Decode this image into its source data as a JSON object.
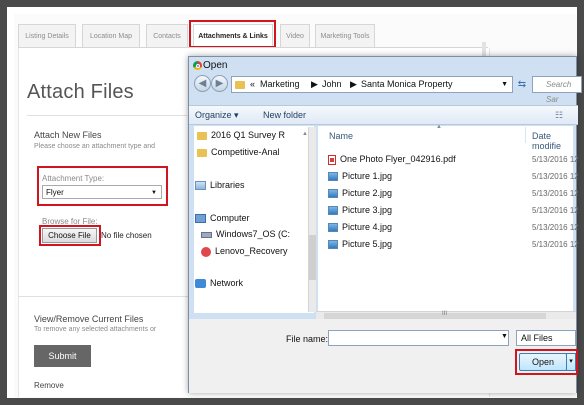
{
  "tabs": [
    "Listing Details",
    "Location Map",
    "Contacts",
    "Attachments & Links",
    "Video",
    "Marketing Tools"
  ],
  "active_tab": "Attachments & Links",
  "page": {
    "title": "Attach Files",
    "attach_new": {
      "heading": "Attach New Files",
      "subtext": "Please choose an attachment type and",
      "type_label": "Attachment Type:",
      "type_value": "Flyer",
      "browse_label": "Browse for File:",
      "choose_button": "Choose File",
      "no_file": "No file chosen"
    },
    "view_remove": {
      "heading": "View/Remove Current Files",
      "subtext": "To remove any selected attachments or"
    },
    "submit_label": "Submit",
    "remove_label": "Remove"
  },
  "dialog": {
    "title": "Open",
    "breadcrumb": {
      "prefix": "«",
      "parts": [
        "Marketing",
        "John",
        "Santa Monica Property"
      ]
    },
    "search_placeholder": "Search Sar",
    "toolbar": {
      "organize": "Organize ▾",
      "new_folder": "New folder"
    },
    "nav_items": [
      {
        "label": "2016 Q1 Survey R",
        "icon": "folder-icon"
      },
      {
        "label": "Competitive-Anal",
        "icon": "folder-icon"
      },
      {
        "label": "Libraries",
        "icon": "libraries-icon"
      },
      {
        "label": "Computer",
        "icon": "computer-icon"
      },
      {
        "label": "Windows7_OS (C:",
        "icon": "drive-icon"
      },
      {
        "label": "Lenovo_Recovery",
        "icon": "recovery-drive-icon"
      },
      {
        "label": "Network",
        "icon": "network-icon"
      }
    ],
    "columns": {
      "name": "Name",
      "date": "Date modifie"
    },
    "files": [
      {
        "name": "One Photo Flyer_042916.pdf",
        "date": "5/13/2016 12",
        "icon": "pdf-icon"
      },
      {
        "name": "Picture 1.jpg",
        "date": "5/13/2016 12",
        "icon": "jpg-icon"
      },
      {
        "name": "Picture 2.jpg",
        "date": "5/13/2016 12",
        "icon": "jpg-icon"
      },
      {
        "name": "Picture 3.jpg",
        "date": "5/13/2016 12",
        "icon": "jpg-icon"
      },
      {
        "name": "Picture 4.jpg",
        "date": "5/13/2016 12",
        "icon": "jpg-icon"
      },
      {
        "name": "Picture 5.jpg",
        "date": "5/13/2016 12",
        "icon": "jpg-icon"
      }
    ],
    "scroll_grip": "III",
    "file_name_label": "File name:",
    "file_name_value": "",
    "file_type": "All Files",
    "open_button": "Open",
    "open_dropdown": "▾"
  },
  "highlight_color": "#d0151f"
}
